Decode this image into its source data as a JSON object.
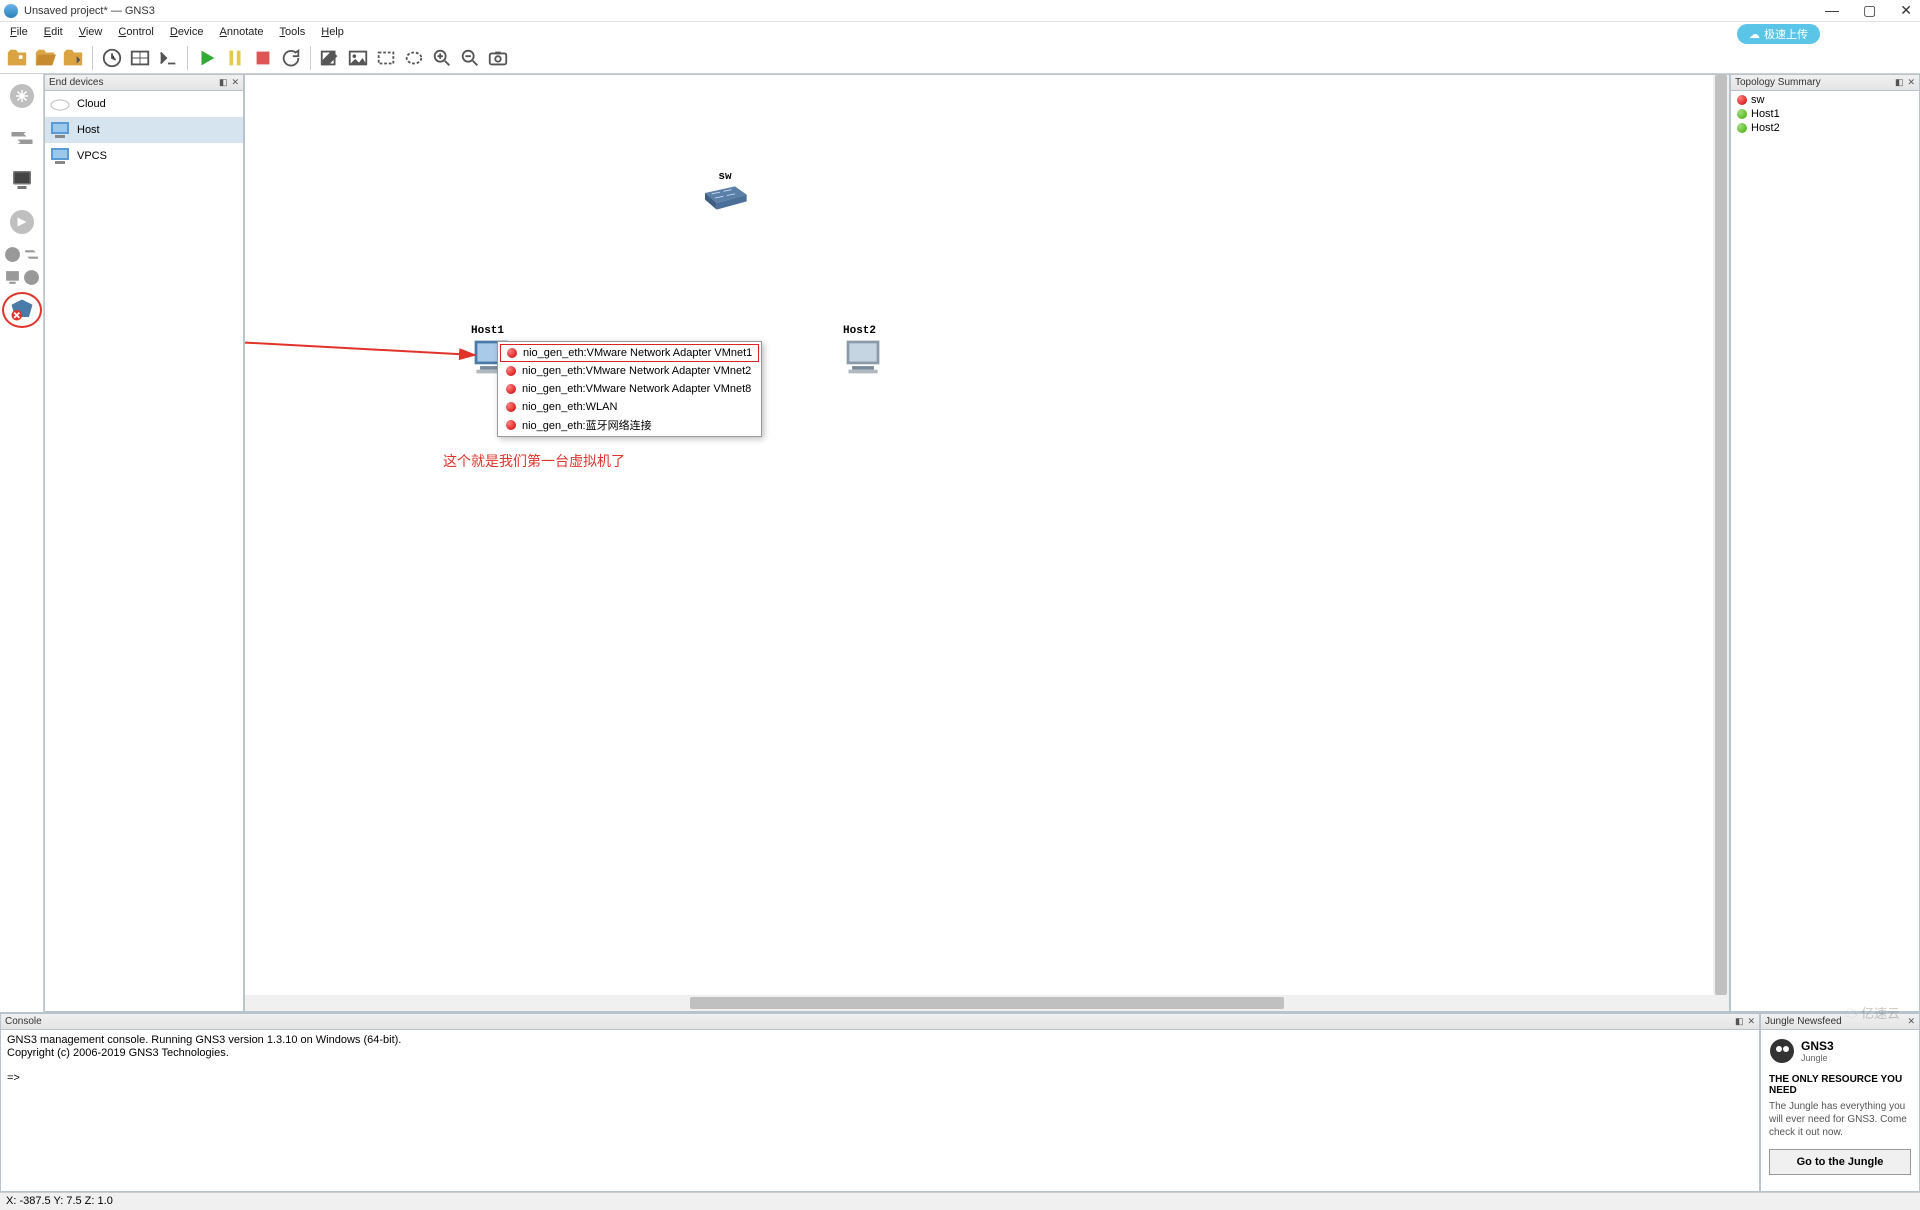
{
  "window": {
    "title": "Unsaved project* — GNS3",
    "upload_label": "极速上传"
  },
  "menu": [
    "File",
    "Edit",
    "View",
    "Control",
    "Device",
    "Annotate",
    "Tools",
    "Help"
  ],
  "devices_panel": {
    "title": "End devices",
    "items": [
      {
        "label": "Cloud",
        "icon": "cloud",
        "selected": false
      },
      {
        "label": "Host",
        "icon": "host",
        "selected": true
      },
      {
        "label": "VPCS",
        "icon": "vpcs",
        "selected": false
      }
    ]
  },
  "canvas": {
    "nodes": {
      "sw": {
        "label": "sw"
      },
      "host1": {
        "label": "Host1"
      },
      "host2": {
        "label": "Host2"
      }
    },
    "context_menu": [
      {
        "label": "nio_gen_eth:VMware Network Adapter VMnet1",
        "selected": true
      },
      {
        "label": "nio_gen_eth:VMware Network Adapter VMnet2",
        "selected": false
      },
      {
        "label": "nio_gen_eth:VMware Network Adapter VMnet8",
        "selected": false
      },
      {
        "label": "nio_gen_eth:WLAN",
        "selected": false
      },
      {
        "label": "nio_gen_eth:蓝牙网络连接",
        "selected": false
      }
    ],
    "annotation": "这个就是我们第一台虚拟机了"
  },
  "topology": {
    "title": "Topology Summary",
    "items": [
      {
        "label": "sw",
        "status": "red"
      },
      {
        "label": "Host1",
        "status": "green"
      },
      {
        "label": "Host2",
        "status": "green"
      }
    ]
  },
  "console": {
    "title": "Console",
    "line1": "GNS3 management console. Running GNS3 version 1.3.10 on Windows (64-bit).",
    "line2": "Copyright (c) 2006-2019 GNS3 Technologies.",
    "prompt": "=>"
  },
  "newsfeed": {
    "title": "Jungle Newsfeed",
    "brand_top": "GNS3",
    "brand_sub": "Jungle",
    "headline": "THE ONLY RESOURCE YOU NEED",
    "body": "The Jungle has everything you will ever need for GNS3. Come check it out now.",
    "button": "Go to the Jungle"
  },
  "statusbar": {
    "left": "X: -387.5 Y: 7.5 Z: 1.0"
  },
  "watermark": "亿速云"
}
